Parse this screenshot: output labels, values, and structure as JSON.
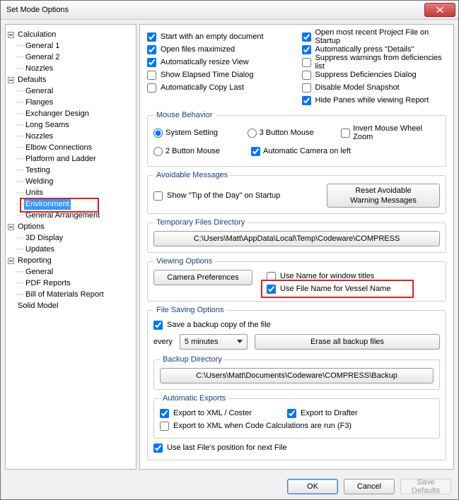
{
  "window": {
    "title": "Set Mode Options"
  },
  "tree": {
    "calculation": "Calculation",
    "calc_general1": "General 1",
    "calc_general2": "General 2",
    "calc_nozzles": "Nozzles",
    "defaults": "Defaults",
    "def_general": "General",
    "def_flanges": "Flanges",
    "def_exchanger": "Exchanger Design",
    "def_longseams": "Long Seams",
    "def_nozzles": "Nozzles",
    "def_elbow": "Elbow Connections",
    "def_platform": "Platform and Ladder",
    "def_testing": "Testing",
    "def_welding": "Welding",
    "def_units": "Units",
    "def_environment": "Environment",
    "def_genarr": "General Arrangement",
    "options": "Options",
    "opt_3d": "3D Display",
    "opt_updates": "Updates",
    "reporting": "Reporting",
    "rep_general": "General",
    "rep_pdf": "PDF Reports",
    "rep_bom": "Bill of Materials Report",
    "solidmodel": "Solid Model"
  },
  "top_left": {
    "start_empty": "Start with an empty document",
    "open_max": "Open files maximized",
    "resize_view": "Automatically resize View",
    "show_elapsed": "Show Elapsed Time Dialog",
    "copy_last": "Automatically Copy Last"
  },
  "top_right": {
    "open_recent": "Open most recent Project File on Startup",
    "press_details": "Automatically press \"Details\"",
    "suppress_warn": "Suppress warnings from deficiencies list",
    "suppress_def": "Suppress Deficiencies Dialog",
    "disable_snap": "Disable Model Snapshot",
    "hide_panes": "Hide Panes while viewing Report"
  },
  "mouse": {
    "legend": "Mouse Behavior",
    "system": "System Setting",
    "three": "3 Button Mouse",
    "invert": "Invert Mouse Wheel Zoom",
    "two": "2 Button Mouse",
    "cam_left": "Automatic Camera on left"
  },
  "avoidable": {
    "legend": "Avoidable Messages",
    "tip": "Show \"Tip of the Day\" on Startup",
    "reset": "Reset Avoidable\nWarning Messages"
  },
  "temp": {
    "legend": "Temporary Files Directory",
    "path": "C:\\Users\\Matt\\AppData\\Local\\Temp\\Codeware\\COMPRESS"
  },
  "viewing": {
    "legend": "Viewing Options",
    "camera_prefs": "Camera Preferences",
    "use_name_title": "Use Name for window titles",
    "use_file_vessel": "Use File Name for Vessel Name"
  },
  "filesave": {
    "legend": "File Saving Options",
    "save_backup": "Save a backup copy of the file",
    "every": "every",
    "interval": "5 minutes",
    "erase": "Erase all backup files"
  },
  "backup": {
    "legend": "Backup Directory",
    "path": "C:\\Users\\Matt\\Documents\\Codeware\\COMPRESS\\Backup"
  },
  "autoexp": {
    "legend": "Automatic Exports",
    "xml_coster": "Export to XML / Coster",
    "drafter": "Export to Drafter",
    "xml_f3": "Export to XML when Code Calculations are run (F3)"
  },
  "lastpos": "Use last File's position for next File",
  "footer": {
    "ok": "OK",
    "cancel": "Cancel",
    "save_defaults": "Save Defaults"
  }
}
